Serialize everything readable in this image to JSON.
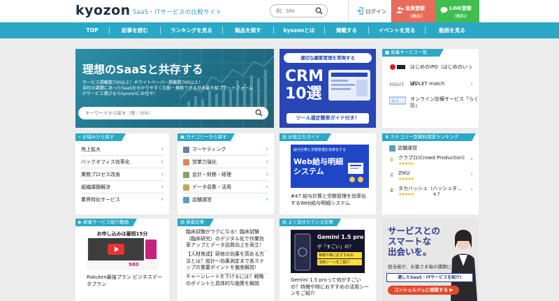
{
  "header": {
    "logo": "kyozon",
    "tagline": "SaaS・ITサービスの比較サイト",
    "search_placeholder": "例：SFA",
    "login_label": "ログイン",
    "member_line1": "会員登録",
    "member_line2": "(無料)",
    "line_line1": "LINE登録",
    "line_line2": "(無料)"
  },
  "nav": [
    "TOP",
    "記事を読む",
    "ランキングを見る",
    "製品を探す",
    "kyozonとは",
    "掲載する",
    "イベントを見る",
    "動画を見る"
  ],
  "hero": {
    "title": "理想のSaaSと共存する",
    "desc_line1": "サービス掲載数700以上！ホワイトペーパー掲載数700以上！",
    "desc_line2": "自社の課題にあったSaaSをわかりやすく比較・検索できる日本最大級プラットフォーム",
    "desc_line3": "ITサービス選びならkyozonにお任せ！",
    "search_placeholder": "キーワードから探す（例：SFA）"
  },
  "crm_banner": {
    "top": "適切な顧客管理を実現する",
    "big1": "CRM",
    "big2": "10選",
    "button": "ツール選定簡単ガイド付き！"
  },
  "new_services": {
    "title": "新着サービス一覧",
    "items": [
      "はじめのIPO（はじめのいっぽ）",
      "VIOLET match",
      "オンライン診療サービス「らく診」"
    ]
  },
  "worries": {
    "title": "お悩みから探す",
    "items": [
      "売上拡大",
      "バックオフィス効率化",
      "業務プロセス改善",
      "組織課題解決",
      "業界特化サービス"
    ]
  },
  "categories": {
    "title": "カテゴリーから探す",
    "items": [
      "マーケティング",
      "営業力強化",
      "会計・財務・経理",
      "データ収集・活用",
      "店舗運営"
    ]
  },
  "guide": {
    "title": "お役立ちガイド",
    "img_line1": "給与計算と労務管理を効率化する",
    "img_big1": "Web給与明細",
    "img_big2": "システム",
    "caption": "#47 給与計算と労務管理を効率化するWeb給与明細システム"
  },
  "ranking": {
    "title": "カテゴリー別資料請求ランキング",
    "category": "店舗運営",
    "items": [
      {
        "name": "クラプロ(Crowd Production)",
        "stars": "★★★★★"
      },
      {
        "name": "ZIKU",
        "stars": "★★★★★"
      },
      {
        "name": "タカハッシュ（ハッシュタ...",
        "stars": "★★★★★",
        "score": "4.7"
      }
    ]
  },
  "service_intro": {
    "title": "新着サービス紹介動画",
    "banner_text": "お申し込みは最短15分",
    "price": "980",
    "caption": "Rakuten最強プラン ビジネスデータプラン"
  },
  "new_articles": {
    "title": "新着記事",
    "article1": "臨床試験がラクになる！臨床試験（臨床研究）のデジタル化で作業効率アップとデータ品質向上を両立！",
    "article2": "【人材育成】研修の効果を高める方法とは？設計〜効果測定まで各ステップの重要ポイントを徹底解説！",
    "article3": "チャーンレートを下げるには？戦略のポイントと具体的な施策を解説"
  },
  "popular": {
    "title": "よく読まれている記事",
    "img_title": "Gemini 1.5 pro",
    "img_sub": "が「すごい」の？",
    "img_tag1": "特徴や特におすすめの",
    "img_tag2": "活用シーンをご紹介",
    "caption": "Gemini 1.5 proって何がすごいの？特徴や特におすすめの活用シーンをご紹介"
  },
  "recruit": {
    "title1": "サービスとの",
    "title2": "スマートな",
    "title3": "出会いを。",
    "sub": "担当者が、お客さま毎の課題に",
    "banner": "適したSaaS・ITサービスを紹介!",
    "button": "コンシェルジュに相談する ▶"
  },
  "colors": {
    "accent": "#2ba8c5",
    "crm_bg": "#2846b6",
    "member": "#e96b5c",
    "line": "#3fbd4f"
  }
}
